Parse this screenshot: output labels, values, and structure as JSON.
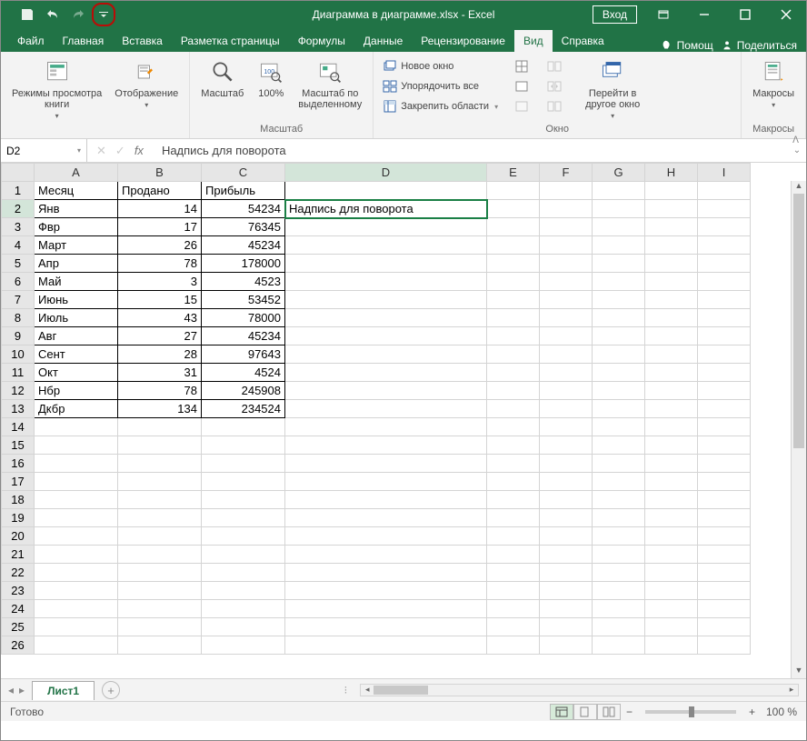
{
  "title": "Диаграмма в диаграмме.xlsx - Excel",
  "signin": "Вход",
  "tabs": [
    "Файл",
    "Главная",
    "Вставка",
    "Разметка страницы",
    "Формулы",
    "Данные",
    "Рецензирование",
    "Вид",
    "Справка"
  ],
  "active_tab": "Вид",
  "help_hint": "Помощ",
  "share": "Поделиться",
  "ribbon": {
    "g1": {
      "btn1": "Режимы просмотра\nкниги",
      "btn2": "Отображение",
      "label": ""
    },
    "zoom": {
      "btn1": "Масштаб",
      "btn2": "100%",
      "btn3": "Масштаб по\nвыделенному",
      "label": "Масштаб"
    },
    "window": {
      "s1": "Новое окно",
      "s2": "Упорядочить все",
      "s3": "Закрепить области",
      "btn_goto": "Перейти в\nдругое окно",
      "label": "Окно"
    },
    "macros": {
      "btn": "Макросы",
      "label": "Макросы"
    }
  },
  "name_box": "D2",
  "formula": "Надпись для поворота",
  "columns": [
    "A",
    "B",
    "C",
    "D",
    "E",
    "F",
    "G",
    "H",
    "I"
  ],
  "data": {
    "headers": [
      "Месяц",
      "Продано",
      "Прибыль"
    ],
    "rows": [
      [
        "Янв",
        14,
        54234
      ],
      [
        "Фвр",
        17,
        76345
      ],
      [
        "Март",
        26,
        45234
      ],
      [
        "Апр",
        78,
        178000
      ],
      [
        "Май",
        3,
        4523
      ],
      [
        "Июнь",
        15,
        53452
      ],
      [
        "Июль",
        43,
        78000
      ],
      [
        "Авг",
        27,
        45234
      ],
      [
        "Сент",
        28,
        97643
      ],
      [
        "Окт",
        31,
        4524
      ],
      [
        "Нбр",
        78,
        245908
      ],
      [
        "Дкбр",
        134,
        234524
      ]
    ],
    "d2": "Надпись для поворота"
  },
  "sheet": "Лист1",
  "status": "Готово",
  "zoom": "100 %"
}
